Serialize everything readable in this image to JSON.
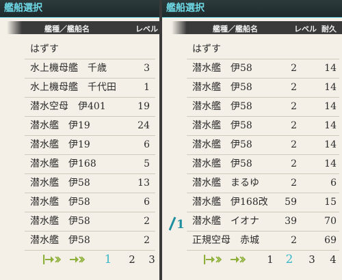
{
  "left_panel": {
    "title": "艦船選択",
    "header": {
      "name": "艦種／艦船名",
      "level": "レベル"
    },
    "remove_label": "はずす",
    "ships": [
      {
        "name": "水上機母艦　千歳",
        "level": "3"
      },
      {
        "name": "水上機母艦　千代田",
        "level": "1"
      },
      {
        "name": "潜水空母　伊401",
        "level": "19"
      },
      {
        "name": "潜水艦　伊19",
        "level": "24"
      },
      {
        "name": "潜水艦　伊19",
        "level": "6"
      },
      {
        "name": "潜水艦　伊168",
        "level": "5"
      },
      {
        "name": "潜水艦　伊58",
        "level": "13"
      },
      {
        "name": "潜水艦　伊58",
        "level": "6"
      },
      {
        "name": "潜水艦　伊58",
        "level": "2"
      },
      {
        "name": "潜水艦　伊58",
        "level": "2"
      }
    ],
    "pager": {
      "pages": [
        "1",
        "2",
        "3"
      ],
      "current": "1"
    }
  },
  "right_panel": {
    "title": "艦船選択",
    "header": {
      "name": "艦種／艦船名",
      "level": "レベル",
      "hp": "耐久"
    },
    "remove_label": "はずす",
    "ships": [
      {
        "name": "潜水艦　伊58",
        "level": "2",
        "hp": "14"
      },
      {
        "name": "潜水艦　伊58",
        "level": "2",
        "hp": "14"
      },
      {
        "name": "潜水艦　伊58",
        "level": "2",
        "hp": "14"
      },
      {
        "name": "潜水艦　伊58",
        "level": "2",
        "hp": "14"
      },
      {
        "name": "潜水艦　伊58",
        "level": "2",
        "hp": "14"
      },
      {
        "name": "潜水艦　伊58",
        "level": "2",
        "hp": "14"
      },
      {
        "name": "潜水艦　まるゆ",
        "level": "2",
        "hp": "6"
      },
      {
        "name": "潜水艦　伊168改",
        "level": "59",
        "hp": "15"
      },
      {
        "name": "潜水艦　イオナ",
        "level": "39",
        "hp": "70"
      },
      {
        "name": "正規空母　赤城",
        "level": "2",
        "hp": "69"
      }
    ],
    "fleet_marker": "1",
    "pager": {
      "pages": [
        "1",
        "2",
        "3",
        "4"
      ],
      "current": "2"
    }
  },
  "colors": {
    "accent": "#3ab7c9",
    "title_text": "#6ed9e6",
    "header_bg": "#3a3a3a",
    "marker": "#1f8fa0",
    "arrow": "#8fb03a"
  },
  "icons": {
    "first_page": "arrow-first-icon",
    "prev_page": "arrow-prev-icon",
    "fleet": "fleet-flag-icon"
  }
}
